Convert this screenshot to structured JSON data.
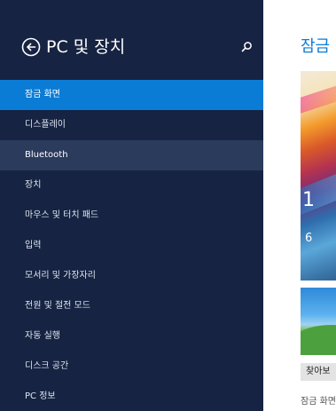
{
  "nav": {
    "title": "PC 및 장치",
    "back_icon": "back-arrow-icon",
    "search_icon": "search-icon",
    "items": [
      {
        "label": "잠금 화면",
        "state": "selected"
      },
      {
        "label": "디스플레이",
        "state": "normal"
      },
      {
        "label": "Bluetooth",
        "state": "hover"
      },
      {
        "label": "장치",
        "state": "normal"
      },
      {
        "label": "마우스 및 터치 패드",
        "state": "normal"
      },
      {
        "label": "입력",
        "state": "normal"
      },
      {
        "label": "모서리 및 가장자리",
        "state": "normal"
      },
      {
        "label": "전원 및 절전 모드",
        "state": "normal"
      },
      {
        "label": "자동 실행",
        "state": "normal"
      },
      {
        "label": "디스크 공간",
        "state": "normal"
      },
      {
        "label": "PC 정보",
        "state": "normal"
      }
    ]
  },
  "content": {
    "title": "잠금",
    "preview_clock": "1",
    "preview_date": "6",
    "browse_label": "찾아보",
    "caption": "잠금 화면"
  },
  "colors": {
    "nav_background": "#162342",
    "selected": "#0a7cd6",
    "hover": "#2b3b5c",
    "accent_text": "#0a7cd6"
  }
}
